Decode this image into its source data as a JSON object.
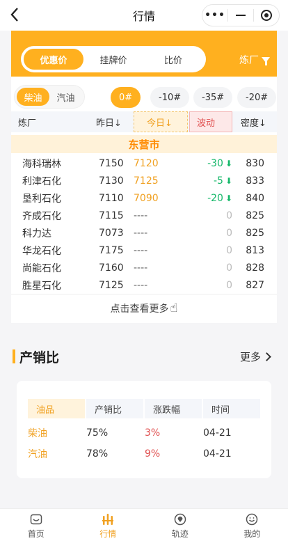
{
  "nav": {
    "title": "行情"
  },
  "price_tabs": [
    {
      "label": "优惠价",
      "active": true
    },
    {
      "label": "挂牌价",
      "active": false
    },
    {
      "label": "比价",
      "active": false
    }
  ],
  "filter_label": "炼厂",
  "fuel_types": [
    {
      "label": "柴油",
      "active": true
    },
    {
      "label": "汽油",
      "active": false
    }
  ],
  "grades": [
    {
      "label": "0#",
      "active": true
    },
    {
      "label": "-10#",
      "active": false
    },
    {
      "label": "-35#",
      "active": false
    },
    {
      "label": "-20#",
      "active": false
    }
  ],
  "table": {
    "headers": {
      "refinery": "炼厂",
      "yesterday": "昨日↓",
      "today": "今日↓",
      "change": "波动",
      "density": "密度↓"
    },
    "region": "东营市",
    "rows": [
      {
        "name": "海科瑞林",
        "yesterday": "7150",
        "today": "7120",
        "change": "-30",
        "density": "830"
      },
      {
        "name": "利津石化",
        "yesterday": "7130",
        "today": "7125",
        "change": "-5",
        "density": "833"
      },
      {
        "name": "垦利石化",
        "yesterday": "7110",
        "today": "7090",
        "change": "-20",
        "density": "840"
      },
      {
        "name": "齐成石化",
        "yesterday": "7115",
        "today": "----",
        "change": "0",
        "density": "825"
      },
      {
        "name": "科力达",
        "yesterday": "7073",
        "today": "----",
        "change": "0",
        "density": "825"
      },
      {
        "name": "华龙石化",
        "yesterday": "7175",
        "today": "----",
        "change": "0",
        "density": "813"
      },
      {
        "name": "尚能石化",
        "yesterday": "7160",
        "today": "----",
        "change": "0",
        "density": "828"
      },
      {
        "name": "胜星石化",
        "yesterday": "7125",
        "today": "----",
        "change": "0",
        "density": "827"
      }
    ],
    "more_text": "点击查看更多"
  },
  "production": {
    "title": "产销比",
    "more": "更多",
    "headers": [
      "油品",
      "产销比",
      "涨跌幅",
      "时间"
    ],
    "rows": [
      {
        "product": "柴油",
        "ratio": "75%",
        "change": "3%",
        "date": "04-21"
      },
      {
        "product": "汽油",
        "ratio": "78%",
        "change": "9%",
        "date": "04-21"
      }
    ]
  },
  "tabbar": [
    {
      "label": "首页",
      "icon": "home-icon",
      "active": false
    },
    {
      "label": "行情",
      "icon": "wheat-icon",
      "active": true
    },
    {
      "label": "轨迹",
      "icon": "track-icon",
      "active": false
    },
    {
      "label": "我的",
      "icon": "profile-icon",
      "active": false
    }
  ],
  "colors": {
    "accent": "#ffb01f",
    "up": "#16b86a",
    "down_red": "#e05050"
  }
}
